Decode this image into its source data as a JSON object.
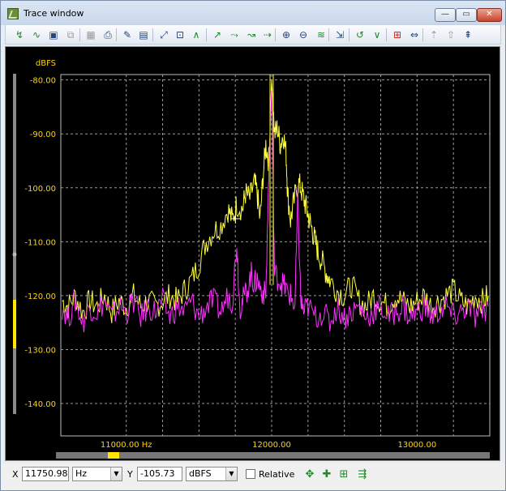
{
  "window": {
    "title": "Trace window"
  },
  "titlebar_buttons": {
    "minimize": "—",
    "maximize": "▭",
    "close": "✕"
  },
  "toolbar": {
    "icons": [
      {
        "name": "trace-green-icon",
        "glyph": "↯",
        "color": "g"
      },
      {
        "name": "trace-wave-icon",
        "glyph": "∿",
        "color": "g"
      },
      {
        "name": "save-icon",
        "glyph": "▣",
        "color": "b"
      },
      {
        "name": "copy-icon",
        "glyph": "⧉",
        "color": "gr"
      },
      {
        "name": "chart-icon",
        "glyph": "▦",
        "color": "gr"
      },
      {
        "name": "print-icon",
        "glyph": "⎙",
        "color": "b"
      },
      {
        "name": "edit-icon",
        "glyph": "✎",
        "color": "b"
      },
      {
        "name": "grid-icon",
        "glyph": "▤",
        "color": "b"
      },
      {
        "name": "zoom-fit-icon",
        "glyph": "⤢",
        "color": "b"
      },
      {
        "name": "zoom-box-icon",
        "glyph": "⊡",
        "color": "b"
      },
      {
        "name": "peak-icon",
        "glyph": "∧",
        "color": "g"
      },
      {
        "name": "marker-1-icon",
        "glyph": "↗",
        "color": "g"
      },
      {
        "name": "marker-2-icon",
        "glyph": "⤳",
        "color": "g"
      },
      {
        "name": "marker-3-icon",
        "glyph": "↝",
        "color": "g"
      },
      {
        "name": "marker-4-icon",
        "glyph": "⇢",
        "color": "g"
      },
      {
        "name": "zoom-in-icon",
        "glyph": "⊕",
        "color": "b"
      },
      {
        "name": "zoom-out-icon",
        "glyph": "⊖",
        "color": "b"
      },
      {
        "name": "fit-trace-icon",
        "glyph": "≋",
        "color": "g"
      },
      {
        "name": "autoscale-icon",
        "glyph": "⇲",
        "color": "b"
      },
      {
        "name": "smooth-icon",
        "glyph": "↺",
        "color": "g"
      },
      {
        "name": "delta-icon",
        "glyph": "∨",
        "color": "g"
      },
      {
        "name": "marker-add-icon",
        "glyph": "⊞",
        "color": "r"
      },
      {
        "name": "arrows-icon",
        "glyph": "⇔",
        "color": "b"
      },
      {
        "name": "marker-gray-icon",
        "glyph": "⇡",
        "color": "gr"
      },
      {
        "name": "marker-up-icon",
        "glyph": "⇧",
        "color": "gr"
      },
      {
        "name": "cursor-icon",
        "glyph": "⇞",
        "color": "b"
      }
    ]
  },
  "chart_data": {
    "type": "line",
    "ylabel": "dBFS",
    "xlabel": "Hz",
    "xlim": [
      10550,
      13500
    ],
    "ylim": [
      -146,
      -79
    ],
    "x_ticks": [
      11000,
      12000,
      13000
    ],
    "x_tick_labels": [
      "11000.00 Hz",
      "12000.00",
      "13000.00"
    ],
    "y_ticks": [
      -80,
      -90,
      -100,
      -110,
      -120,
      -130,
      -140
    ],
    "y_tick_labels": [
      "-80.00",
      "-90.00",
      "-100.00",
      "-110.00",
      "-120.00",
      "-130.00",
      "-140.00"
    ],
    "grid": true,
    "series": [
      {
        "color": "#ffff3a",
        "points": [
          [
            10560,
            -121
          ],
          [
            10600,
            -122
          ],
          [
            10650,
            -120
          ],
          [
            10700,
            -123
          ],
          [
            10750,
            -121
          ],
          [
            10800,
            -122
          ],
          [
            10850,
            -120
          ],
          [
            10900,
            -123
          ],
          [
            10950,
            -121
          ],
          [
            11000,
            -122
          ],
          [
            11050,
            -120
          ],
          [
            11100,
            -122
          ],
          [
            11150,
            -121
          ],
          [
            11200,
            -122
          ],
          [
            11250,
            -121
          ],
          [
            11300,
            -120
          ],
          [
            11350,
            -121
          ],
          [
            11400,
            -119
          ],
          [
            11450,
            -117
          ],
          [
            11500,
            -114
          ],
          [
            11550,
            -110
          ],
          [
            11600,
            -108
          ],
          [
            11650,
            -107
          ],
          [
            11700,
            -104
          ],
          [
            11730,
            -106
          ],
          [
            11760,
            -103
          ],
          [
            11800,
            -104
          ],
          [
            11820,
            -101
          ],
          [
            11850,
            -102
          ],
          [
            11880,
            -99
          ],
          [
            11900,
            -101
          ],
          [
            11920,
            -106
          ],
          [
            11940,
            -98
          ],
          [
            11960,
            -92
          ],
          [
            11980,
            -95
          ],
          [
            12000,
            -80
          ],
          [
            12020,
            -90
          ],
          [
            12040,
            -89
          ],
          [
            12060,
            -92
          ],
          [
            12080,
            -90
          ],
          [
            12100,
            -94
          ],
          [
            12110,
            -101
          ],
          [
            12130,
            -106
          ],
          [
            12150,
            -103
          ],
          [
            12180,
            -99
          ],
          [
            12200,
            -100
          ],
          [
            12220,
            -102
          ],
          [
            12240,
            -104
          ],
          [
            12260,
            -106
          ],
          [
            12280,
            -108
          ],
          [
            12300,
            -110
          ],
          [
            12320,
            -112
          ],
          [
            12350,
            -114
          ],
          [
            12380,
            -116
          ],
          [
            12400,
            -117
          ],
          [
            12450,
            -119
          ],
          [
            12500,
            -120
          ],
          [
            12550,
            -118
          ],
          [
            12600,
            -121
          ],
          [
            12650,
            -122
          ],
          [
            12700,
            -120
          ],
          [
            12750,
            -121
          ],
          [
            12800,
            -122
          ],
          [
            12850,
            -120
          ],
          [
            12900,
            -121
          ],
          [
            12950,
            -122
          ],
          [
            13000,
            -121
          ],
          [
            13050,
            -120
          ],
          [
            13100,
            -122
          ],
          [
            13150,
            -121
          ],
          [
            13200,
            -120
          ],
          [
            13250,
            -119
          ],
          [
            13300,
            -121
          ],
          [
            13350,
            -122
          ],
          [
            13400,
            -120
          ],
          [
            13450,
            -121
          ],
          [
            13490,
            -120
          ]
        ]
      },
      {
        "color": "#ff30ff",
        "points": [
          [
            10560,
            -122
          ],
          [
            10600,
            -124
          ],
          [
            10650,
            -121
          ],
          [
            10700,
            -125
          ],
          [
            10750,
            -122
          ],
          [
            10800,
            -123
          ],
          [
            10850,
            -121
          ],
          [
            10900,
            -124
          ],
          [
            10950,
            -122
          ],
          [
            11000,
            -123
          ],
          [
            11050,
            -121
          ],
          [
            11100,
            -124
          ],
          [
            11150,
            -122
          ],
          [
            11200,
            -123
          ],
          [
            11250,
            -121
          ],
          [
            11300,
            -124
          ],
          [
            11350,
            -122
          ],
          [
            11400,
            -123
          ],
          [
            11450,
            -121
          ],
          [
            11500,
            -124
          ],
          [
            11550,
            -122
          ],
          [
            11600,
            -121
          ],
          [
            11650,
            -123
          ],
          [
            11700,
            -120
          ],
          [
            11730,
            -121
          ],
          [
            11760,
            -110
          ],
          [
            11780,
            -122
          ],
          [
            11800,
            -121
          ],
          [
            11830,
            -119
          ],
          [
            11860,
            -116
          ],
          [
            11880,
            -118
          ],
          [
            11900,
            -117
          ],
          [
            11930,
            -119
          ],
          [
            11960,
            -120
          ],
          [
            11980,
            -98
          ],
          [
            12000,
            -82
          ],
          [
            12020,
            -116
          ],
          [
            12050,
            -117
          ],
          [
            12080,
            -118
          ],
          [
            12100,
            -119
          ],
          [
            12130,
            -120
          ],
          [
            12160,
            -122
          ],
          [
            12180,
            -102
          ],
          [
            12200,
            -121
          ],
          [
            12220,
            -123
          ],
          [
            12250,
            -122
          ],
          [
            12300,
            -124
          ],
          [
            12350,
            -123
          ],
          [
            12400,
            -125
          ],
          [
            12450,
            -122
          ],
          [
            12500,
            -124
          ],
          [
            12550,
            -123
          ],
          [
            12600,
            -122
          ],
          [
            12650,
            -124
          ],
          [
            12700,
            -123
          ],
          [
            12750,
            -122
          ],
          [
            12800,
            -124
          ],
          [
            12850,
            -123
          ],
          [
            12900,
            -122
          ],
          [
            12950,
            -124
          ],
          [
            13000,
            -123
          ],
          [
            13050,
            -122
          ],
          [
            13100,
            -124
          ],
          [
            13150,
            -123
          ],
          [
            13200,
            -122
          ],
          [
            13250,
            -124
          ],
          [
            13300,
            -123
          ],
          [
            13350,
            -122
          ],
          [
            13400,
            -124
          ],
          [
            13450,
            -123
          ],
          [
            13490,
            -122
          ]
        ]
      }
    ]
  },
  "status": {
    "x_label": "X",
    "x_value": "11750.98",
    "x_unit": "Hz",
    "y_label": "Y",
    "y_value": "-105.73",
    "y_unit": "dBFS",
    "relative_label": "Relative",
    "relative_checked": false,
    "icons": [
      {
        "name": "move-marker-icon",
        "glyph": "✥"
      },
      {
        "name": "add-marker-icon",
        "glyph": "✚"
      },
      {
        "name": "delete-marker-icon",
        "glyph": "⊞"
      },
      {
        "name": "marker-list-icon",
        "glyph": "⇶"
      }
    ]
  }
}
